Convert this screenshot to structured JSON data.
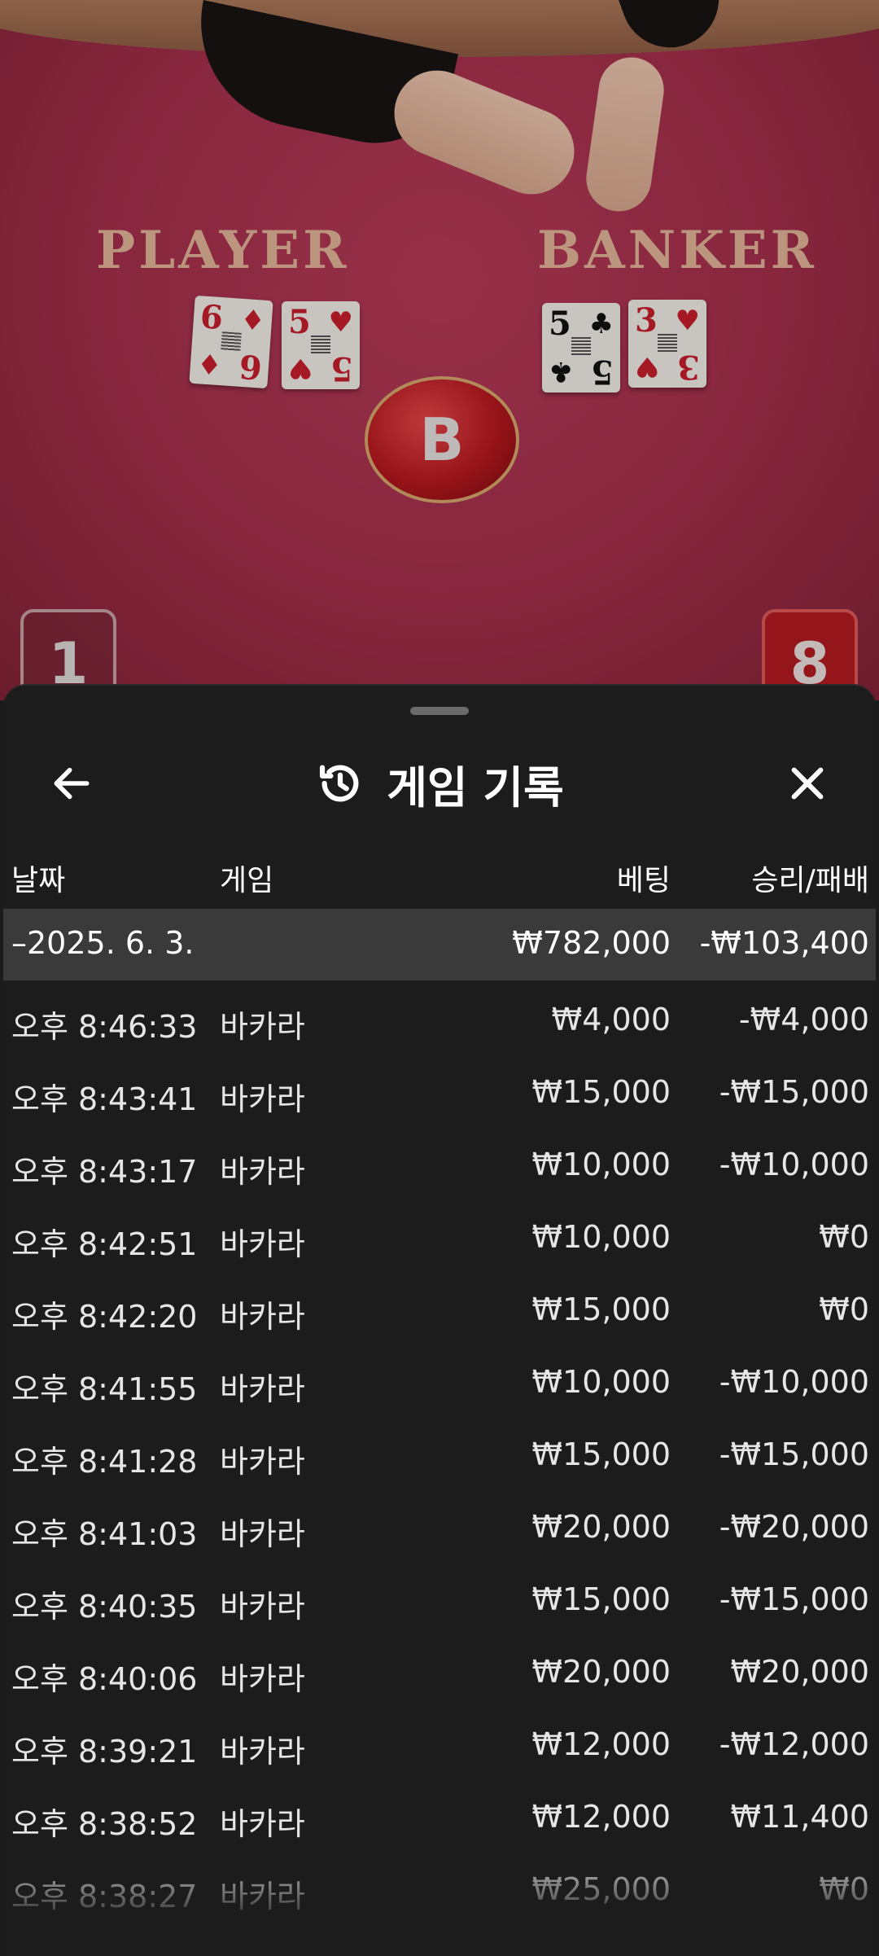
{
  "table": {
    "player_label": "PLAYER",
    "banker_label": "BANKER",
    "player_cards": [
      {
        "rank": "6",
        "suit": "♦",
        "color": "red"
      },
      {
        "rank": "5",
        "suit": "♥",
        "color": "red"
      }
    ],
    "banker_cards": [
      {
        "rank": "5",
        "suit": "♣",
        "color": "black"
      },
      {
        "rank": "3",
        "suit": "♥",
        "color": "red"
      }
    ],
    "winner_chip": "B",
    "player_score": "1",
    "banker_score": "8"
  },
  "sheet": {
    "title": "게임 기록",
    "back_icon": "arrow-left-icon",
    "history_icon": "history-icon",
    "close_icon": "close-icon",
    "columns": {
      "date": "날짜",
      "game": "게임",
      "bet": "베팅",
      "win_loss": "승리/패배"
    },
    "summary": {
      "date": "–2025. 6. 3.",
      "bet": "₩782,000",
      "win_loss": "-₩103,400"
    },
    "rows": [
      {
        "time": "오후 8:46:33",
        "game": "바카라",
        "bet": "₩4,000",
        "win_loss": "-₩4,000"
      },
      {
        "time": "오후 8:43:41",
        "game": "바카라",
        "bet": "₩15,000",
        "win_loss": "-₩15,000"
      },
      {
        "time": "오후 8:43:17",
        "game": "바카라",
        "bet": "₩10,000",
        "win_loss": "-₩10,000"
      },
      {
        "time": "오후 8:42:51",
        "game": "바카라",
        "bet": "₩10,000",
        "win_loss": "₩0"
      },
      {
        "time": "오후 8:42:20",
        "game": "바카라",
        "bet": "₩15,000",
        "win_loss": "₩0"
      },
      {
        "time": "오후 8:41:55",
        "game": "바카라",
        "bet": "₩10,000",
        "win_loss": "-₩10,000"
      },
      {
        "time": "오후 8:41:28",
        "game": "바카라",
        "bet": "₩15,000",
        "win_loss": "-₩15,000"
      },
      {
        "time": "오후 8:41:03",
        "game": "바카라",
        "bet": "₩20,000",
        "win_loss": "-₩20,000"
      },
      {
        "time": "오후 8:40:35",
        "game": "바카라",
        "bet": "₩15,000",
        "win_loss": "-₩15,000"
      },
      {
        "time": "오후 8:40:06",
        "game": "바카라",
        "bet": "₩20,000",
        "win_loss": "₩20,000"
      },
      {
        "time": "오후 8:39:21",
        "game": "바카라",
        "bet": "₩12,000",
        "win_loss": "-₩12,000"
      },
      {
        "time": "오후 8:38:52",
        "game": "바카라",
        "bet": "₩12,000",
        "win_loss": "₩11,400"
      },
      {
        "time": "오후 8:38:27",
        "game": "바카라",
        "bet": "₩25,000",
        "win_loss": "₩0"
      }
    ]
  }
}
